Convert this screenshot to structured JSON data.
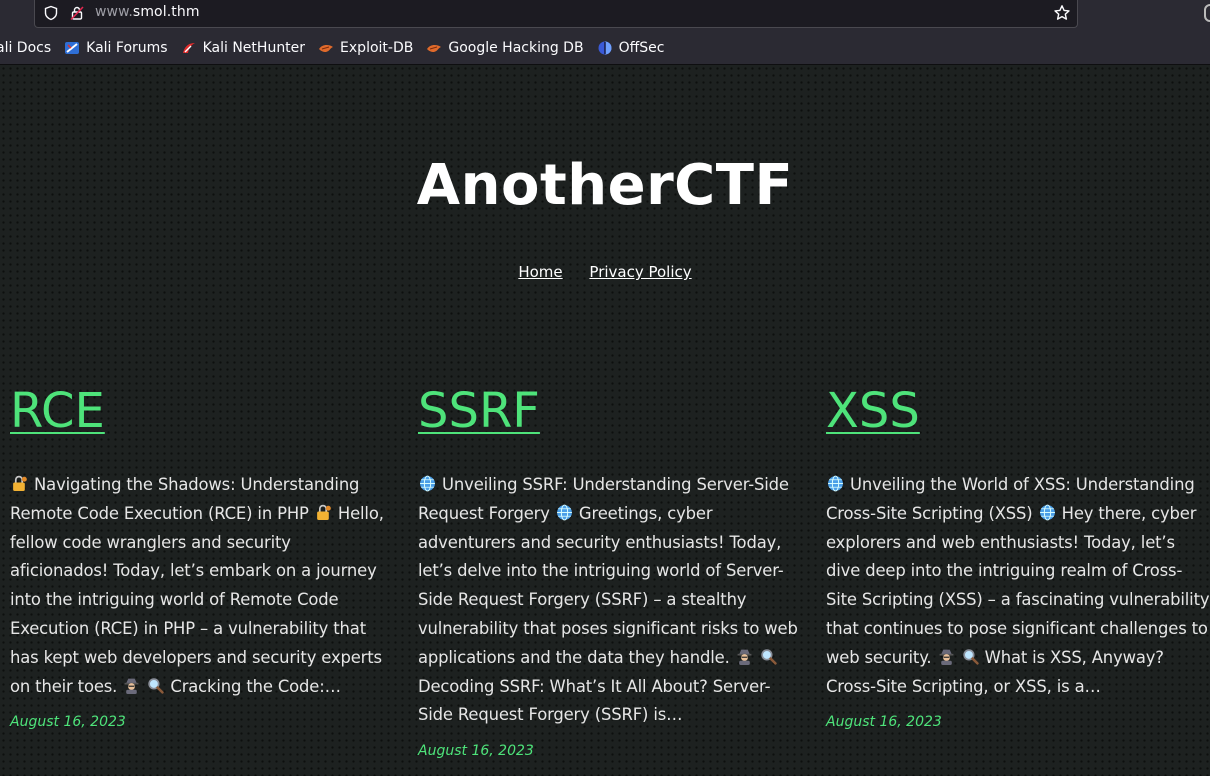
{
  "browser": {
    "url_prefix": "www.",
    "url_domain": "smol.thm",
    "bookmarks": [
      {
        "label": "ali Docs",
        "icon": "kali-docs-icon"
      },
      {
        "label": "Kali Forums",
        "icon": "kali-forums-icon"
      },
      {
        "label": "Kali NetHunter",
        "icon": "nethunter-icon"
      },
      {
        "label": "Exploit-DB",
        "icon": "exploit-db-icon"
      },
      {
        "label": "Google Hacking DB",
        "icon": "ghdb-icon"
      },
      {
        "label": "OffSec",
        "icon": "offsec-icon"
      }
    ]
  },
  "site": {
    "title": "AnotherCTF",
    "nav": [
      "Home",
      "Privacy Policy"
    ]
  },
  "posts": [
    {
      "title": "RCE",
      "excerpt_html_parts": [
        "lock",
        " Navigating the Shadows: Understanding Remote Code Execution (RCE) in PHP ",
        "lock",
        " Hello, fellow code wranglers and security aficionados! Today, let’s embark on a journey into the intriguing world of Remote Code Execution (RCE) in PHP – a vulnerability that has kept web developers and security experts on their toes. ",
        "spy",
        " ",
        "magnifier",
        " Cracking the Code:…"
      ],
      "date": "August 16, 2023"
    },
    {
      "title": "SSRF",
      "excerpt_html_parts": [
        "globe",
        " Unveiling SSRF: Understanding Server-Side Request Forgery ",
        "globe",
        " Greetings, cyber adventurers and security enthusiasts! Today, let’s delve into the intriguing world of Server-Side Request Forgery (SSRF) – a stealthy vulnerability that poses significant risks to web applications and the data they handle. ",
        "spy",
        " ",
        "magnifier",
        " Decoding SSRF: What’s It All About? Server-Side Request Forgery (SSRF) is…"
      ],
      "date": "August 16, 2023"
    },
    {
      "title": "XSS",
      "excerpt_html_parts": [
        "globe",
        " Unveiling the World of XSS: Understanding Cross-Site Scripting (XSS) ",
        "globe",
        " Hey there, cyber explorers and web enthusiasts! Today, let’s dive deep into the intriguing realm of Cross-Site Scripting (XSS) – a fascinating vulnerability that continues to pose significant challenges to web security. ",
        "spy",
        " ",
        "magnifier",
        " What is XSS, Anyway? Cross-Site Scripting, or XSS, is a…"
      ],
      "date": "August 16, 2023"
    }
  ],
  "colors": {
    "accent": "#4ee37a",
    "background": "#1d2120",
    "chrome": "#2b2a33"
  }
}
